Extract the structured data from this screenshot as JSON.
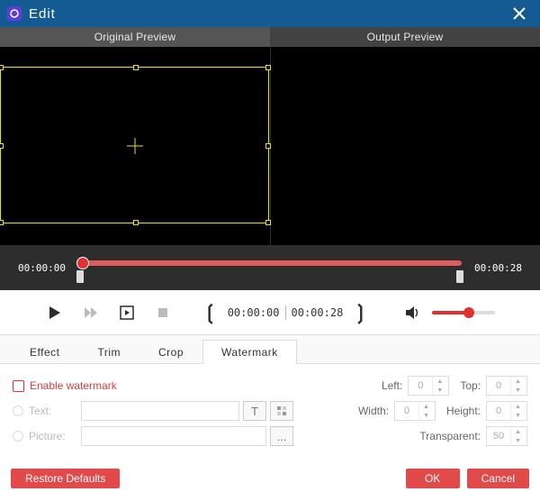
{
  "title": "Edit",
  "previews": {
    "left": "Original Preview",
    "right": "Output Preview"
  },
  "timeline": {
    "start": "00:00:00",
    "end": "00:00:28"
  },
  "time": {
    "current": "00:00:00",
    "total": "00:00:28"
  },
  "tabs": [
    "Effect",
    "Trim",
    "Crop",
    "Watermark"
  ],
  "watermark": {
    "enable": "Enable watermark",
    "text": "Text:",
    "picture": "Picture:",
    "browse": "...",
    "left": "Left:",
    "top": "Top:",
    "width": "Width:",
    "height": "Height:",
    "transparent": "Transparent:",
    "v_left": "0",
    "v_top": "0",
    "v_width": "0",
    "v_height": "0",
    "v_trans": "50"
  },
  "buttons": {
    "restore": "Restore Defaults",
    "ok": "OK",
    "cancel": "Cancel"
  }
}
